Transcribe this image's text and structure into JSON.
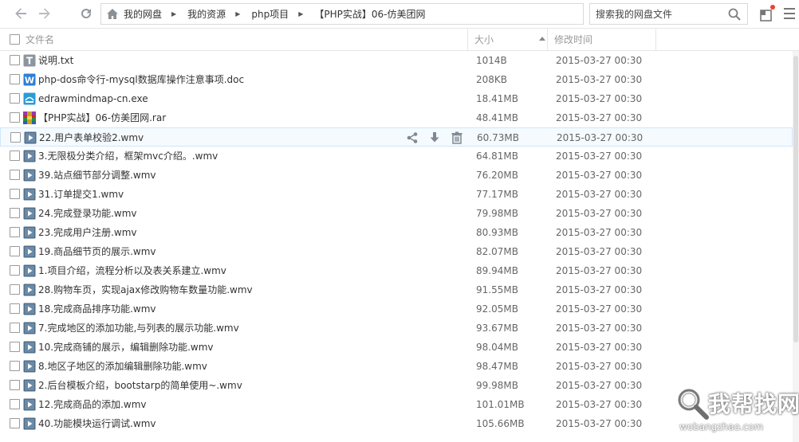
{
  "toolbar": {
    "back_icon": "arrow-left-icon",
    "forward_icon": "arrow-right-icon",
    "refresh_icon": "refresh-icon",
    "breadcrumb": [
      "我的网盘",
      "我的资源",
      "php项目",
      "【PHP实战】06-仿美团网"
    ],
    "search_placeholder": "搜索我的网盘文件"
  },
  "header": {
    "name_label": "文件名",
    "size_label": "大小",
    "date_label": "修改时间"
  },
  "files": [
    {
      "name": "说明.txt",
      "size": "1014B",
      "date": "2015-03-27 00:30",
      "icon": "txt"
    },
    {
      "name": "php-dos命令行-mysql数据库操作注意事项.doc",
      "size": "208KB",
      "date": "2015-03-27 00:30",
      "icon": "doc"
    },
    {
      "name": "edrawmindmap-cn.exe",
      "size": "18.41MB",
      "date": "2015-03-27 00:30",
      "icon": "exe"
    },
    {
      "name": "【PHP实战】06-仿美团网.rar",
      "size": "48.41MB",
      "date": "2015-03-27 00:30",
      "icon": "rar"
    },
    {
      "name": "22.用户表单校验2.wmv",
      "size": "60.73MB",
      "date": "2015-03-27 00:30",
      "icon": "video",
      "hover": true
    },
    {
      "name": "3.无限极分类介绍，框架mvc介绍。.wmv",
      "size": "64.81MB",
      "date": "2015-03-27 00:30",
      "icon": "video"
    },
    {
      "name": "39.站点细节部分调整.wmv",
      "size": "76.20MB",
      "date": "2015-03-27 00:30",
      "icon": "video"
    },
    {
      "name": "31.订单提交1.wmv",
      "size": "77.17MB",
      "date": "2015-03-27 00:30",
      "icon": "video"
    },
    {
      "name": "24.完成登录功能.wmv",
      "size": "79.98MB",
      "date": "2015-03-27 00:30",
      "icon": "video"
    },
    {
      "name": "23.完成用户注册.wmv",
      "size": "80.93MB",
      "date": "2015-03-27 00:30",
      "icon": "video"
    },
    {
      "name": "19.商品细节页的展示.wmv",
      "size": "82.07MB",
      "date": "2015-03-27 00:30",
      "icon": "video"
    },
    {
      "name": "1.项目介绍，流程分析以及表关系建立.wmv",
      "size": "89.94MB",
      "date": "2015-03-27 00:30",
      "icon": "video"
    },
    {
      "name": "28.购物车页，实现ajax修改购物车数量功能.wmv",
      "size": "91.55MB",
      "date": "2015-03-27 00:30",
      "icon": "video"
    },
    {
      "name": "18.完成商品排序功能.wmv",
      "size": "92.05MB",
      "date": "2015-03-27 00:30",
      "icon": "video"
    },
    {
      "name": "7.完成地区的添加功能,与列表的展示功能.wmv",
      "size": "93.67MB",
      "date": "2015-03-27 00:30",
      "icon": "video"
    },
    {
      "name": "10.完成商铺的展示，编辑删除功能.wmv",
      "size": "98.04MB",
      "date": "2015-03-27 00:30",
      "icon": "video"
    },
    {
      "name": "8.地区子地区的添加编辑删除功能.wmv",
      "size": "98.47MB",
      "date": "2015-03-27 00:30",
      "icon": "video"
    },
    {
      "name": "2.后台模板介绍，bootstarp的简单使用~.wmv",
      "size": "99.98MB",
      "date": "2015-03-27 00:30",
      "icon": "video"
    },
    {
      "name": "12.完成商品的添加.wmv",
      "size": "101.01MB",
      "date": "2015-03-27 00:30",
      "icon": "video"
    },
    {
      "name": "40.功能模块运行调试.wmv",
      "size": "105.66MB",
      "date": "2015-03-27 00:30",
      "icon": "video"
    }
  ],
  "row_actions": [
    "share-icon",
    "download-icon",
    "delete-icon"
  ],
  "watermark": {
    "title": "我帮找网",
    "domain": "wobangzhao.com"
  }
}
